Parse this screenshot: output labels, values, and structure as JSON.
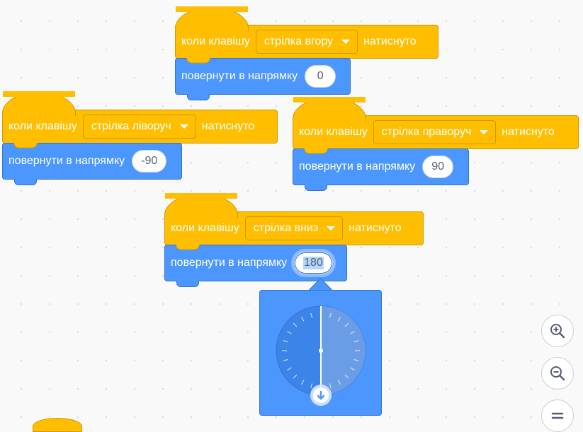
{
  "scripts": [
    {
      "hat_prefix": "коли клавішу",
      "key": "стрілка вгору",
      "hat_suffix": "натиснуто",
      "motion_label": "повернути в напрямку",
      "direction": "0"
    },
    {
      "hat_prefix": "коли клавішу",
      "key": "стрілка ліворуч",
      "hat_suffix": "натиснуто",
      "motion_label": "повернути в напрямку",
      "direction": "-90"
    },
    {
      "hat_prefix": "коли клавішу",
      "key": "стрілка праворуч",
      "hat_suffix": "натиснуто",
      "motion_label": "повернути в напрямку",
      "direction": "90"
    },
    {
      "hat_prefix": "коли клавішу",
      "key": "стрілка вниз",
      "hat_suffix": "натиснуто",
      "motion_label": "повернути в напрямку",
      "direction": "180"
    }
  ],
  "dial": {
    "value_degrees": 180
  },
  "zoom": {
    "zoom_in_icon": "zoom-in-icon",
    "zoom_out_icon": "zoom-out-icon",
    "reset_icon": "zoom-reset-icon"
  },
  "colors": {
    "events": "#ffbf00",
    "motion": "#4c97ff",
    "canvas": "#f9f9f9"
  }
}
